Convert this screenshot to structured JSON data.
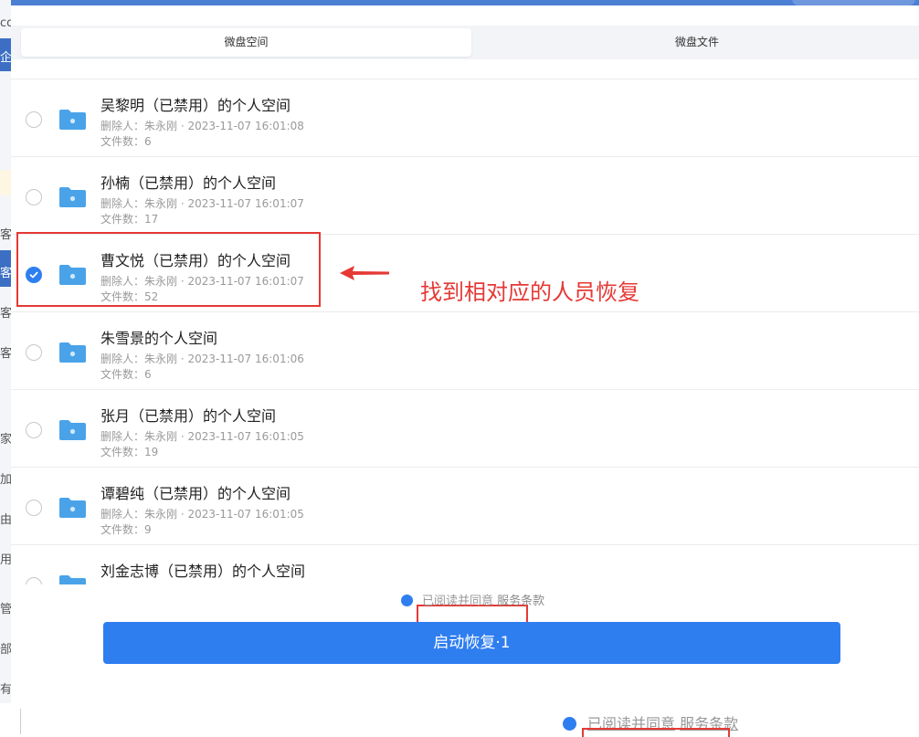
{
  "tabs": [
    {
      "label": "微盘空间",
      "active": true
    },
    {
      "label": "微盘文件",
      "active": false
    }
  ],
  "items": [
    {
      "title": "吴黎明（已禁用）的个人空间",
      "deleter": "删除人：朱永刚 · 2023-11-07 16:01:08",
      "count": "文件数：6",
      "checked": false
    },
    {
      "title": "孙楠（已禁用）的个人空间",
      "deleter": "删除人：朱永刚 · 2023-11-07 16:01:07",
      "count": "文件数：17",
      "checked": false
    },
    {
      "title": "曹文悦（已禁用）的个人空间",
      "deleter": "删除人：朱永刚 · 2023-11-07 16:01:07",
      "count": "文件数：52",
      "checked": true
    },
    {
      "title": "朱雪景的个人空间",
      "deleter": "删除人：朱永刚 · 2023-11-07 16:01:06",
      "count": "文件数：6",
      "checked": false
    },
    {
      "title": "张月（已禁用）的个人空间",
      "deleter": "删除人：朱永刚 · 2023-11-07 16:01:05",
      "count": "文件数：19",
      "checked": false
    },
    {
      "title": "谭碧纯（已禁用）的个人空间",
      "deleter": "删除人：朱永刚 · 2023-11-07 16:01:05",
      "count": "文件数：9",
      "checked": false
    },
    {
      "title": "刘金志博（已禁用）的个人空间",
      "deleter": "",
      "count": "",
      "checked": false
    }
  ],
  "annotation": {
    "text": "找到相对应的人员恢复"
  },
  "footer": {
    "agree_prefix": "已阅读并同意",
    "agree_link": "服务条款",
    "start_button": "启动恢复·1"
  },
  "background_page": {
    "agree_prefix": "已阅读并同意",
    "agree_link": "服务条款",
    "left_chars": [
      "co",
      "企",
      "客",
      "客",
      "客",
      "客",
      "家",
      "加",
      "由",
      "用",
      "管",
      "部",
      "有"
    ]
  },
  "colors": {
    "accent": "#2f7ef0",
    "annotation": "#e53935",
    "folder": "#4aa3e8"
  }
}
